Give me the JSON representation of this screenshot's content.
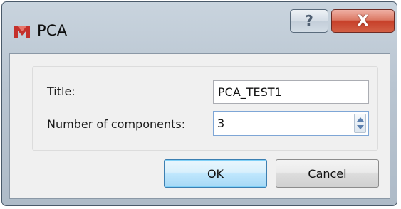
{
  "window": {
    "title": "PCA",
    "app_icon": "app-logo-icon",
    "help_symbol": "?",
    "close_symbol": "X"
  },
  "form": {
    "title_label": "Title:",
    "title_value": "PCA_TEST1",
    "components_label": "Number of components:",
    "components_value": "3"
  },
  "buttons": {
    "ok_label": "OK",
    "cancel_label": "Cancel"
  },
  "colors": {
    "ok_accent": "#3c7fb1",
    "close_accent": "#c7402a",
    "logo": "#c4302b"
  }
}
